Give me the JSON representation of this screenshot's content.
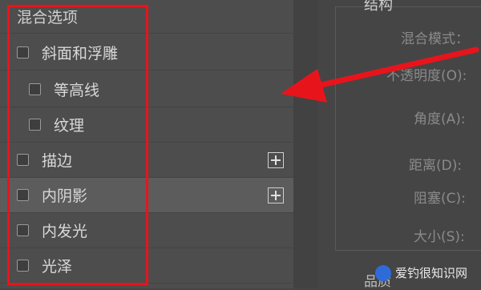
{
  "left_panel": {
    "header": "混合选项",
    "items": [
      {
        "label": "斜面和浮雕",
        "checked": false
      },
      {
        "label": "等高线",
        "checked": false
      },
      {
        "label": "纹理",
        "checked": false
      },
      {
        "label": "描边",
        "checked": false
      },
      {
        "label": "内阴影",
        "checked": false
      },
      {
        "label": "内发光",
        "checked": false
      },
      {
        "label": "光泽",
        "checked": false
      }
    ],
    "selected_item": "内阴影"
  },
  "right_panel": {
    "title_partial": "结构",
    "fields": {
      "blend_mode": "混合模式：",
      "opacity": "不透明度(O):",
      "angle": "角度(A):",
      "distance": "距离(D):",
      "choke": "阻塞(C):",
      "size": "大小(S):"
    },
    "bottom_partial": "品质"
  },
  "annotation": {
    "box_color": "#e8141c",
    "arrow_color": "#e8141c"
  },
  "watermark": {
    "text": "爱钓很知识网"
  }
}
